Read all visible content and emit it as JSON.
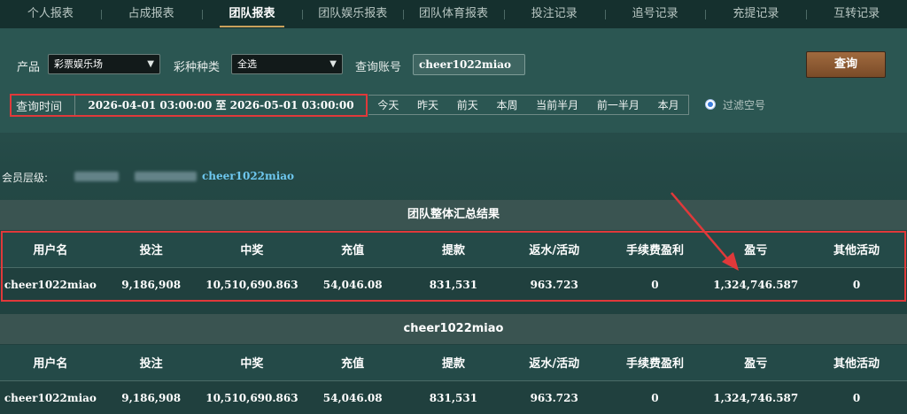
{
  "nav": {
    "items": [
      "个人报表",
      "占成报表",
      "团队报表",
      "团队娱乐报表",
      "团队体育报表",
      "投注记录",
      "追号记录",
      "充提记录",
      "互转记录"
    ],
    "active_index": 2
  },
  "filter": {
    "product_label": "产品",
    "product_value": "彩票娱乐场",
    "lottery_type_label": "彩种种类",
    "lottery_type_value": "全选",
    "account_label": "查询账号",
    "account_value": "cheer1022miao",
    "query_button": "查询",
    "time_label": "查询时间",
    "time_range": "2026-04-01 03:00:00 至 2026-05-01 03:00:00",
    "quick_ranges": [
      "今天",
      "昨天",
      "前天",
      "本周",
      "当前半月",
      "前一半月",
      "本月"
    ],
    "filter_empty_label": "过滤空号"
  },
  "member_level": {
    "label": "会员层级:",
    "account": "cheer1022miao"
  },
  "summary": {
    "title": "团队整体汇总结果",
    "columns": [
      "用户名",
      "投注",
      "中奖",
      "充值",
      "提款",
      "返水/活动",
      "手续费盈利",
      "盈亏",
      "其他活动"
    ],
    "rows": [
      [
        "cheer1022miao",
        "9,186,908",
        "10,510,690.863",
        "54,046.08",
        "831,531",
        "963.723",
        "0",
        "1,324,746.587",
        "0"
      ]
    ]
  },
  "detail": {
    "title": "cheer1022miao",
    "columns": [
      "用户名",
      "投注",
      "中奖",
      "充值",
      "提款",
      "返水/活动",
      "手续费盈利",
      "盈亏",
      "其他活动"
    ],
    "rows": [
      [
        "cheer1022miao",
        "9,186,908",
        "10,510,690.863",
        "54,046.08",
        "831,531",
        "963.723",
        "0",
        "1,324,746.587",
        "0"
      ]
    ]
  },
  "colors": {
    "highlight": "#e0393a",
    "accent_link": "#6ec7ef",
    "query_button": "#8a5a33"
  }
}
